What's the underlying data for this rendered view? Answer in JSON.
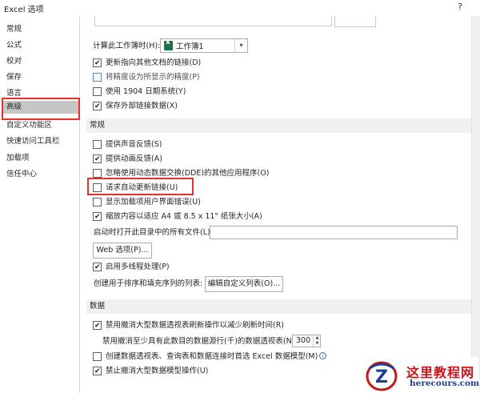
{
  "window": {
    "title": "Excel 选项",
    "help": "?"
  },
  "sidebar": {
    "items": [
      {
        "label": "常规"
      },
      {
        "label": "公式"
      },
      {
        "label": "校对"
      },
      {
        "label": "保存"
      },
      {
        "label": "语言"
      },
      {
        "label": "高级",
        "selected": true
      },
      {
        "label": "自定义功能区"
      },
      {
        "label": "快速访问工具栏"
      },
      {
        "label": "加载项"
      },
      {
        "label": "信任中心"
      }
    ]
  },
  "workbook_calc": {
    "header": "计算此工作簿时(H):",
    "workbook_select": "工作簿1",
    "options": [
      {
        "label": "更新指向其他文档的链接(D)",
        "checked": true
      },
      {
        "label": "将精度设为所显示的精度(P)",
        "checked": false
      },
      {
        "label": "使用 1904 日期系统(Y)",
        "checked": false
      },
      {
        "label": "保存外部链接数据(X)",
        "checked": true
      }
    ]
  },
  "general": {
    "header": "常规",
    "options": [
      {
        "label": "提供声音反馈(S)",
        "checked": false
      },
      {
        "label": "提供动画反馈(A)",
        "checked": true
      },
      {
        "label": "忽略使用动态数据交换(DDE)的其他应用程序(O)",
        "checked": false
      },
      {
        "label": "请求自动更新链接(U)",
        "checked": false
      },
      {
        "label": "显示加载项用户界面错误(U)",
        "checked": false
      },
      {
        "label": "缩放内容以适应 A4 或 8.5 x 11\" 纸张大小(A)",
        "checked": true
      }
    ],
    "startup_label": "启动时打开此目录中的所有文件(L):",
    "startup_value": "",
    "web_options_button": "Web 选项(P)...",
    "multithread": {
      "label": "启用多线程处理(P)",
      "checked": true
    },
    "custom_lists_label": "创建用于排序和填充序列的列表:",
    "custom_lists_button": "编辑自定义列表(O)..."
  },
  "data": {
    "header": "数据",
    "disable_undo_pivot": {
      "label": "禁用撤消大型数据透视表刷新操作以减少刷新时间(R)",
      "checked": true
    },
    "min_rows_label": "禁用撤消至少具有此数目的数据源行(千)的数据透视表(N):",
    "min_rows_value": "300",
    "prefer_model": {
      "label": "创建数据透视表、查询表和数据连接时首选 Excel 数据模型(M)",
      "checked": false
    },
    "disable_undo_model": {
      "label": "禁止撤消大型数据模型操作(U)",
      "checked": true
    }
  },
  "watermark": {
    "cn": "这里教程网",
    "en": "herecours.com",
    "emblem": "Z"
  }
}
